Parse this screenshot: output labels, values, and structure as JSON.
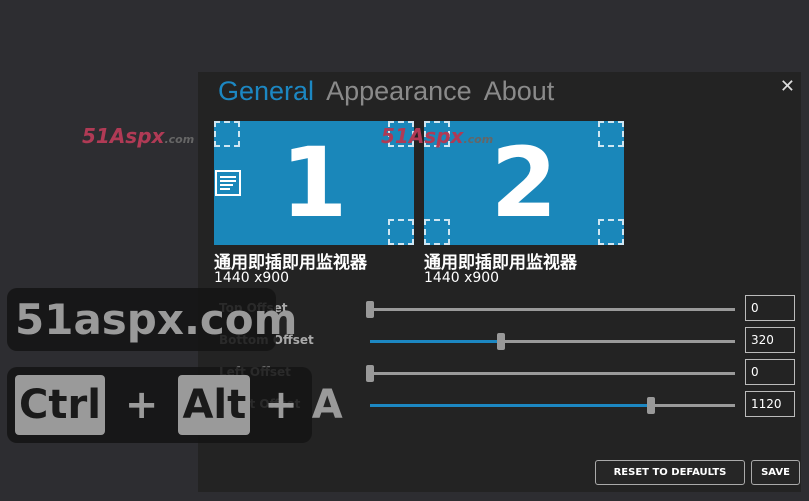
{
  "tabs": [
    {
      "label": "General",
      "active": true
    },
    {
      "label": "Appearance",
      "active": false
    },
    {
      "label": "About",
      "active": false
    }
  ],
  "close_icon": "close-icon",
  "monitors": [
    {
      "number": "1",
      "name": "通用即插即用监视器",
      "resolution": "1440 x900",
      "primary": true
    },
    {
      "number": "2",
      "name": "通用即插即用监视器",
      "resolution": "1440 x900",
      "primary": false
    }
  ],
  "offsets": [
    {
      "label": "Top Offset",
      "value": "0",
      "fraction": 0
    },
    {
      "label": "Bottom Offset",
      "value": "320",
      "fraction": 0.36
    },
    {
      "label": "Left Offset",
      "value": "0",
      "fraction": 0
    },
    {
      "label": "Right Offset",
      "value": "1120",
      "fraction": 0.77
    }
  ],
  "buttons": {
    "reset": "RESET TO DEFAULTS",
    "save": "SAVE"
  },
  "watermark": {
    "brand": "51Aspx",
    "suffix": ".com",
    "site": "51aspx.com"
  },
  "shortcut": {
    "key1": "Ctrl",
    "plus": "+",
    "key2": "Alt",
    "key3": "A"
  },
  "colors": {
    "accent": "#1c87c2",
    "monitor": "#1a87ba",
    "background": "#2d2d31",
    "panel": "#232323"
  }
}
